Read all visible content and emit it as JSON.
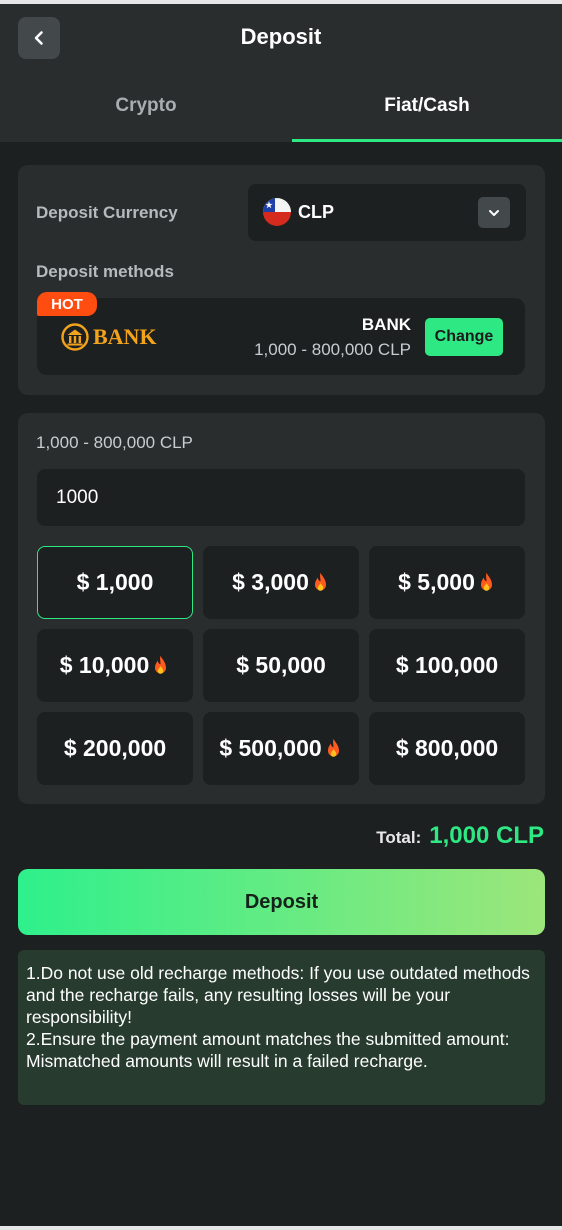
{
  "header": {
    "title": "Deposit",
    "back_icon": "chevron-left-icon"
  },
  "tabs": [
    {
      "label": "Crypto",
      "active": false
    },
    {
      "label": "Fiat/Cash",
      "active": true
    }
  ],
  "currency": {
    "label": "Deposit Currency",
    "selected": "CLP",
    "flag_icon": "chile-flag-icon",
    "dropdown_icon": "chevron-down-icon"
  },
  "methods": {
    "label": "Deposit methods",
    "badge": "HOT",
    "logo_text": "BANK",
    "name": "BANK",
    "range": "1,000 - 800,000 CLP",
    "change_label": "Change"
  },
  "amount": {
    "range_label": "1,000 - 800,000 CLP",
    "input_value": "1000",
    "options": [
      {
        "label": "$ 1,000",
        "hot": false,
        "selected": true
      },
      {
        "label": "$ 3,000",
        "hot": true,
        "selected": false
      },
      {
        "label": "$ 5,000",
        "hot": true,
        "selected": false
      },
      {
        "label": "$ 10,000",
        "hot": true,
        "selected": false
      },
      {
        "label": "$ 50,000",
        "hot": false,
        "selected": false
      },
      {
        "label": "$ 100,000",
        "hot": false,
        "selected": false
      },
      {
        "label": "$ 200,000",
        "hot": false,
        "selected": false
      },
      {
        "label": "$ 500,000",
        "hot": true,
        "selected": false
      },
      {
        "label": "$ 800,000",
        "hot": false,
        "selected": false
      }
    ]
  },
  "total": {
    "label": "Total:",
    "value": "1,000 CLP"
  },
  "deposit_button": "Deposit",
  "notice": {
    "line1": "1.Do not use old recharge methods: If you use outdated methods and the recharge fails, any resulting losses will be your responsibility!",
    "line2": "2.Ensure the payment amount matches the submitted amount: Mismatched amounts will result in a failed recharge."
  },
  "colors": {
    "accent": "#2ee883",
    "background": "#1d2021",
    "card": "#2a2d2e",
    "hot": "#ff4d12",
    "notice_bg": "#273b2f"
  }
}
